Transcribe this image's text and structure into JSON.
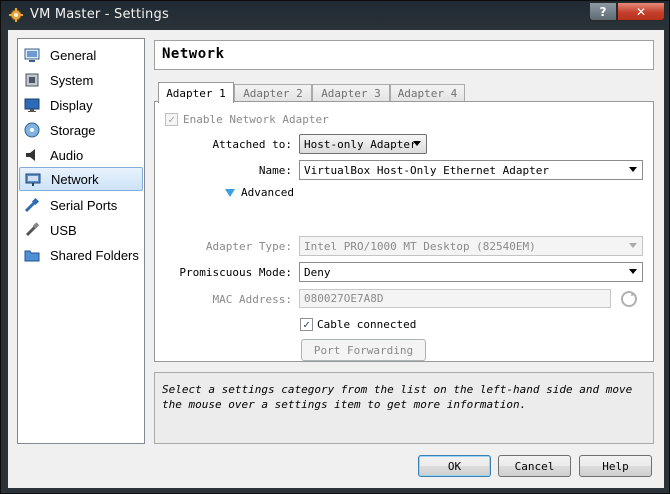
{
  "window": {
    "title": "VM Master - Settings",
    "help_glyph": "?",
    "close_glyph": "✕"
  },
  "sidebar": {
    "items": [
      {
        "label": "General",
        "icon": "general-icon"
      },
      {
        "label": "System",
        "icon": "system-icon"
      },
      {
        "label": "Display",
        "icon": "display-icon"
      },
      {
        "label": "Storage",
        "icon": "storage-icon"
      },
      {
        "label": "Audio",
        "icon": "audio-icon"
      },
      {
        "label": "Network",
        "icon": "network-icon",
        "selected": true
      },
      {
        "label": "Serial Ports",
        "icon": "serial-ports-icon"
      },
      {
        "label": "USB",
        "icon": "usb-icon"
      },
      {
        "label": "Shared Folders",
        "icon": "shared-folders-icon"
      }
    ]
  },
  "page": {
    "title": "Network"
  },
  "tabs": [
    {
      "label": "Adapter 1",
      "active": true
    },
    {
      "label": "Adapter 2"
    },
    {
      "label": "Adapter 3"
    },
    {
      "label": "Adapter 4"
    }
  ],
  "adapter": {
    "enable_label": "Enable Network Adapter",
    "enable_checked": true,
    "attached_label": "Attached to:",
    "attached_value": "Host-only Adapter",
    "name_label": "Name:",
    "name_value": "VirtualBox Host-Only Ethernet Adapter",
    "advanced_label": "Advanced",
    "type_label": "Adapter Type:",
    "type_value": "Intel PRO/1000 MT Desktop (82540EM)",
    "promisc_label": "Promiscuous Mode:",
    "promisc_value": "Deny",
    "mac_label": "MAC Address:",
    "mac_value": "080027OE7A8D",
    "cable_label": "Cable connected",
    "cable_checked": true,
    "port_forwarding_label": "Port Forwarding"
  },
  "info": {
    "text": "Select a settings category from the list on the left-hand side and move the mouse over a settings item to get more information."
  },
  "buttons": {
    "ok": "OK",
    "cancel": "Cancel",
    "help": "Help"
  }
}
